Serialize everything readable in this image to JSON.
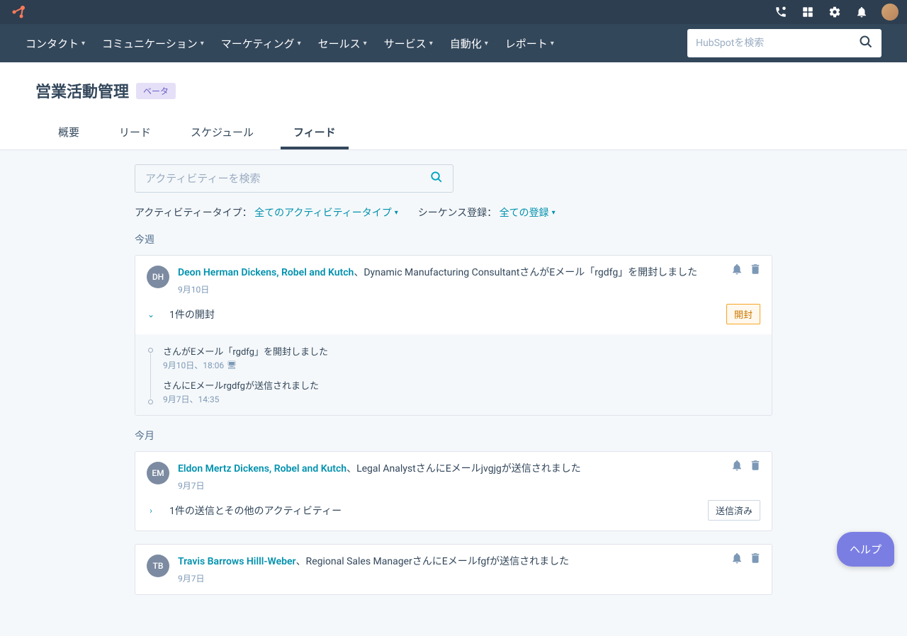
{
  "nav": {
    "items": [
      "コンタクト",
      "コミュニケーション",
      "マーケティング",
      "セールス",
      "サービス",
      "自動化",
      "レポート"
    ]
  },
  "search": {
    "placeholder": "HubSpotを検索"
  },
  "page": {
    "title": "営業活動管理",
    "beta": "ベータ"
  },
  "tabs": [
    "概要",
    "リード",
    "スケジュール",
    "フィード"
  ],
  "activeTab": 3,
  "activitySearch": {
    "placeholder": "アクティビティーを検索"
  },
  "filters": {
    "typeLabel": "アクティビティータイプ：",
    "typeValue": "全てのアクティビティータイプ",
    "seqLabel": "シーケンス登録：",
    "seqValue": "全ての登録"
  },
  "sections": {
    "thisWeek": "今週",
    "thisMonth": "今月"
  },
  "cards": [
    {
      "initials": "DH",
      "contact": "Deon Herman Dickens, Robel and Kutch",
      "rest": "、Dynamic Manufacturing ConsultantさんがEメール「rgdfg」を開封しました",
      "date": "9月10日",
      "expandLabel": "1件の開封",
      "status": "開封",
      "statusKind": "open",
      "expanded": true,
      "timeline": [
        {
          "text": "さんがEメール「rgdfg」を開封しました",
          "date": "9月10日、18:06",
          "icon": true
        },
        {
          "text": "さんにEメールrgdfgが送信されました",
          "date": "9月7日、14:35",
          "icon": false
        }
      ]
    },
    {
      "initials": "EM",
      "contact": "Eldon Mertz Dickens, Robel and Kutch",
      "rest": "、Legal AnalystさんにEメールjvgjgが送信されました",
      "date": "9月7日",
      "expandLabel": "1件の送信とその他のアクティビティー",
      "status": "送信済み",
      "statusKind": "sent",
      "expanded": false
    },
    {
      "initials": "TB",
      "contact": "Travis Barrows Hilll-Weber",
      "rest": "、Regional Sales ManagerさんにEメールfgfが送信されました",
      "date": "9月7日"
    }
  ],
  "help": "ヘルプ"
}
